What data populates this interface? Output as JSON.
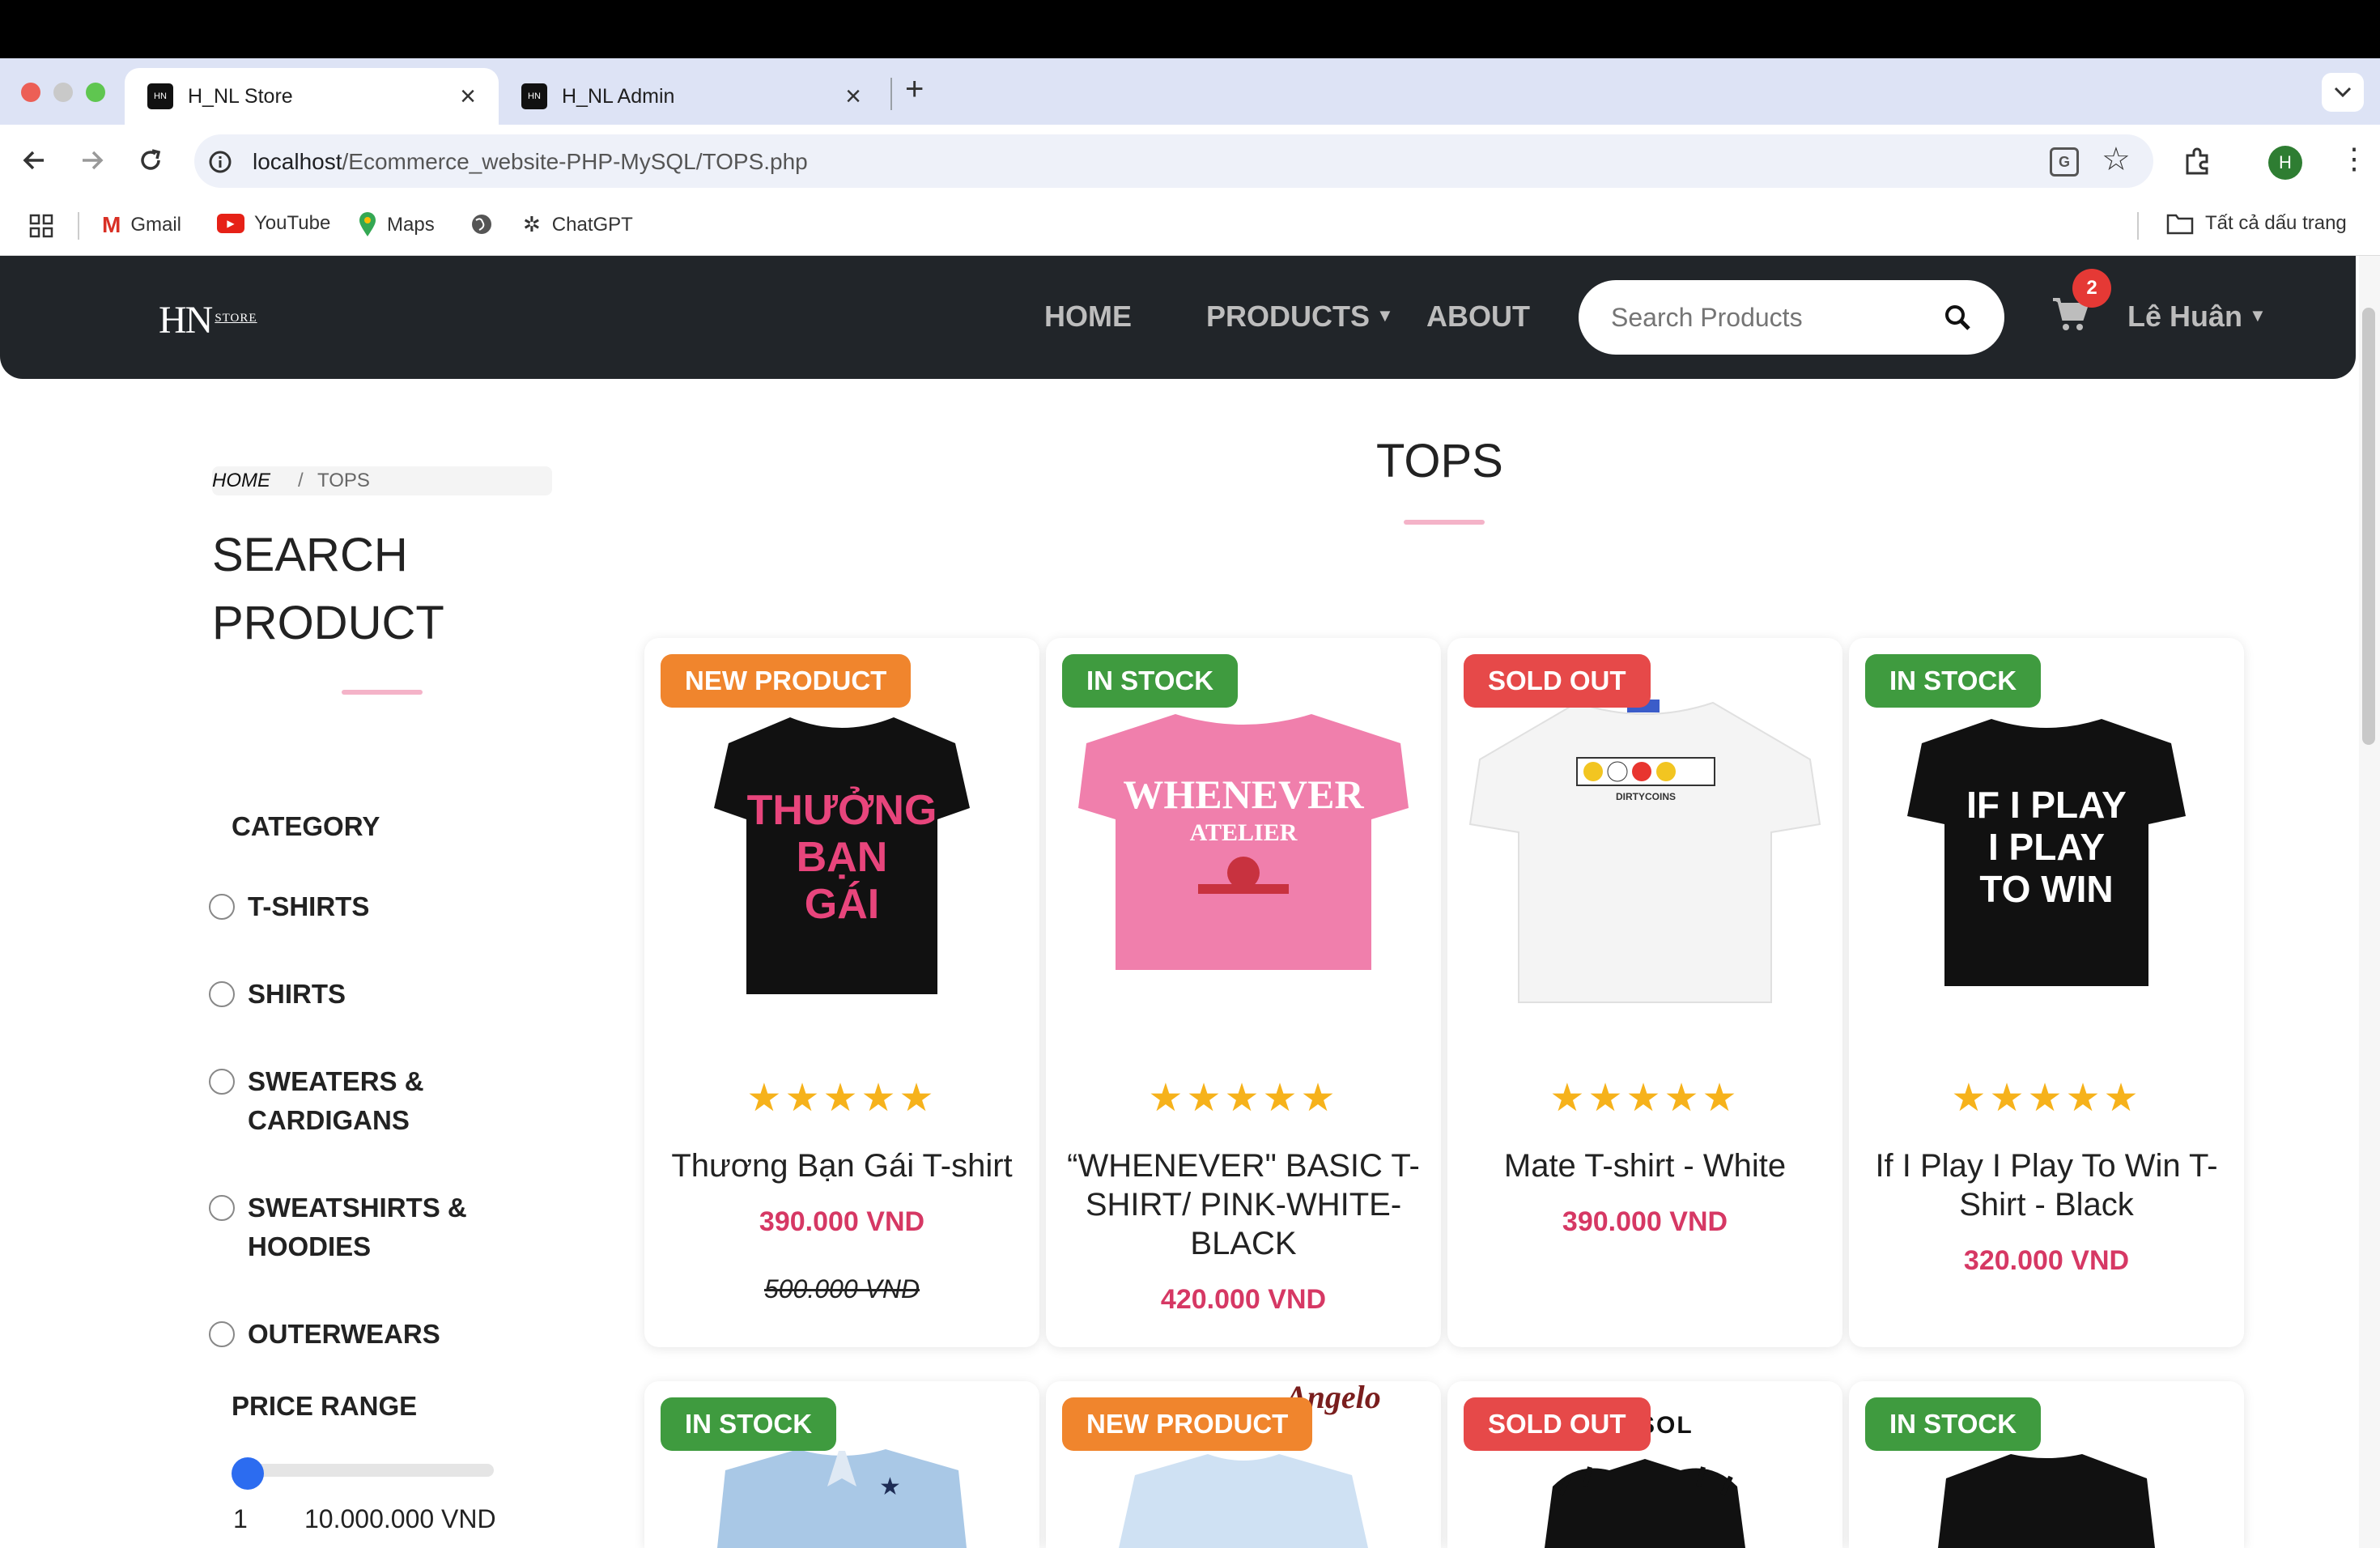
{
  "browser": {
    "tabs": [
      {
        "title": "H_NL Store"
      },
      {
        "title": "H_NL Admin"
      }
    ],
    "url_host": "localhost",
    "url_path": "/Ecommerce_website-PHP-MySQL/TOPS.php",
    "profile_initial": "H",
    "bookmarks": [
      "Gmail",
      "YouTube",
      "Maps",
      "ChatGPT"
    ],
    "all_bookmarks": "Tất cả dấu trang"
  },
  "nav": {
    "logo_main": "HN",
    "logo_small": "STORE",
    "links": [
      "HOME",
      "PRODUCTS",
      "ABOUT"
    ],
    "search_placeholder": "Search Products",
    "cart_count": "2",
    "user_name": "Lê Huân"
  },
  "sidebar": {
    "breadcrumb_home": "HOME",
    "breadcrumb_sep": "/",
    "breadcrumb_current": "TOPS",
    "search_title_line1": "SEARCH",
    "search_title_line2": "PRODUCT",
    "category_title": "CATEGORY",
    "categories": [
      {
        "line1": "T-SHIRTS",
        "line2": ""
      },
      {
        "line1": "SHIRTS",
        "line2": ""
      },
      {
        "line1": "SWEATERS &",
        "line2": "CARDIGANS"
      },
      {
        "line1": "SWEATSHIRTS &",
        "line2": "HOODIES"
      },
      {
        "line1": "OUTERWEARS",
        "line2": ""
      }
    ],
    "price_title": "PRICE RANGE",
    "price_min": "1",
    "price_max": "10.000.000 VND",
    "price_value_fraction": 0
  },
  "main": {
    "title": "TOPS",
    "products": [
      {
        "badge": "NEW PRODUCT",
        "badge_color": "#f0852d",
        "name_lines": [
          "Thương Bạn Gái T-shirt"
        ],
        "price": "390.000 VND",
        "old_price": "500.000 VND",
        "stars": "★★★★★",
        "shirt_color": "#111111",
        "print_text": "THƯƠNG BẠN GÁI",
        "print_color": "#e8457c"
      },
      {
        "badge": "IN STOCK",
        "badge_color": "#3f9b3f",
        "name_lines": [
          "“WHENEVER\" BASIC T-",
          "SHIRT/ PINK-WHITE-",
          "BLACK"
        ],
        "price": "420.000 VND",
        "old_price": "",
        "stars": "★★★★★",
        "shirt_color": "#f07fac",
        "print_text": "WHENEVER ATELIER",
        "print_color": "#ffffff"
      },
      {
        "badge": "SOLD OUT",
        "badge_color": "#e64949",
        "name_lines": [
          "Mate T-shirt - White"
        ],
        "price": "390.000 VND",
        "old_price": "",
        "stars": "★★★★★",
        "shirt_color": "#f4f4f4",
        "print_text": "DIRTYCOINS",
        "print_color": "#333333"
      },
      {
        "badge": "IN STOCK",
        "badge_color": "#3f9b3f",
        "name_lines": [
          "If I Play I Play To Win T-",
          "Shirt - Black"
        ],
        "price": "320.000 VND",
        "old_price": "",
        "stars": "★★★★★",
        "shirt_color": "#111111",
        "print_text": "IF I PLAY I PLAY TO WIN",
        "print_color": "#ffffff"
      }
    ],
    "products_row2": [
      {
        "badge": "IN STOCK",
        "badge_color": "#3f9b3f",
        "shirt_color": "#a9c8e6",
        "logo_text": ""
      },
      {
        "badge": "NEW PRODUCT",
        "badge_color": "#f0852d",
        "shirt_color": "#cfe1f3",
        "logo_text": "Angelo"
      },
      {
        "badge": "SOLD OUT",
        "badge_color": "#e64949",
        "shirt_color": "#111111",
        "logo_text": "SOL"
      },
      {
        "badge": "IN STOCK",
        "badge_color": "#3f9b3f",
        "shirt_color": "#111111",
        "logo_text": ""
      }
    ]
  }
}
